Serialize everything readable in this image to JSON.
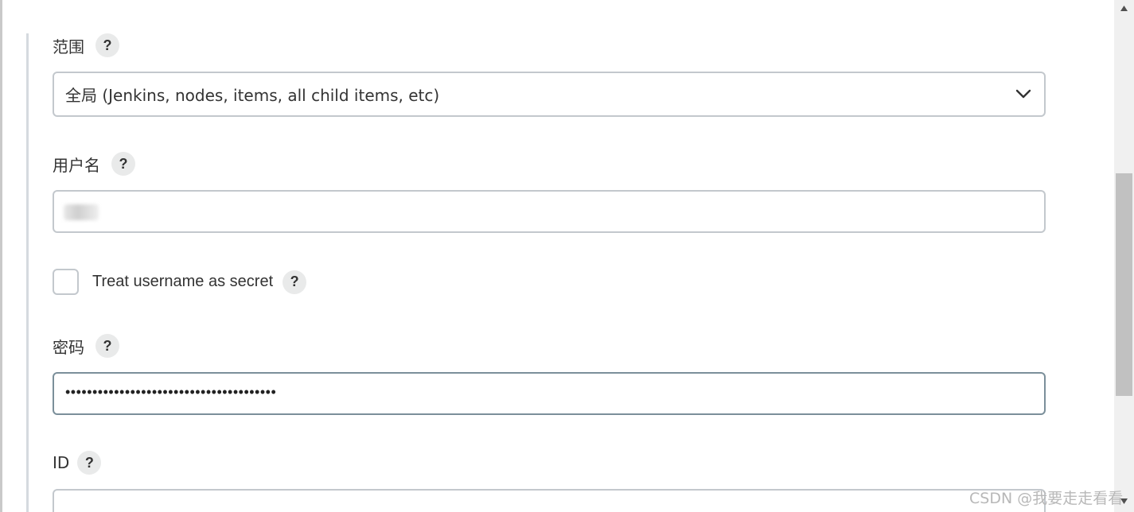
{
  "form": {
    "scope": {
      "label": "范围",
      "help": "?",
      "selected_value": "全局 (Jenkins, nodes, items, all child items, etc)"
    },
    "username": {
      "label": "用户名",
      "help": "?",
      "value": ""
    },
    "treat_username_as_secret": {
      "label": "Treat username as secret",
      "checked": false,
      "help": "?"
    },
    "password": {
      "label": "密码",
      "help": "?",
      "masked_value": "•••••••••••••••••••••••••••••••••••••••"
    },
    "id": {
      "label": "ID",
      "help": "?",
      "value": ""
    }
  },
  "watermark": "CSDN @我要走走看看",
  "colors": {
    "border": "#c3c8cd",
    "focused_border": "#7b8f9a",
    "help_bg": "#e9eaea",
    "scroll_thumb": "#c1c1c1"
  }
}
